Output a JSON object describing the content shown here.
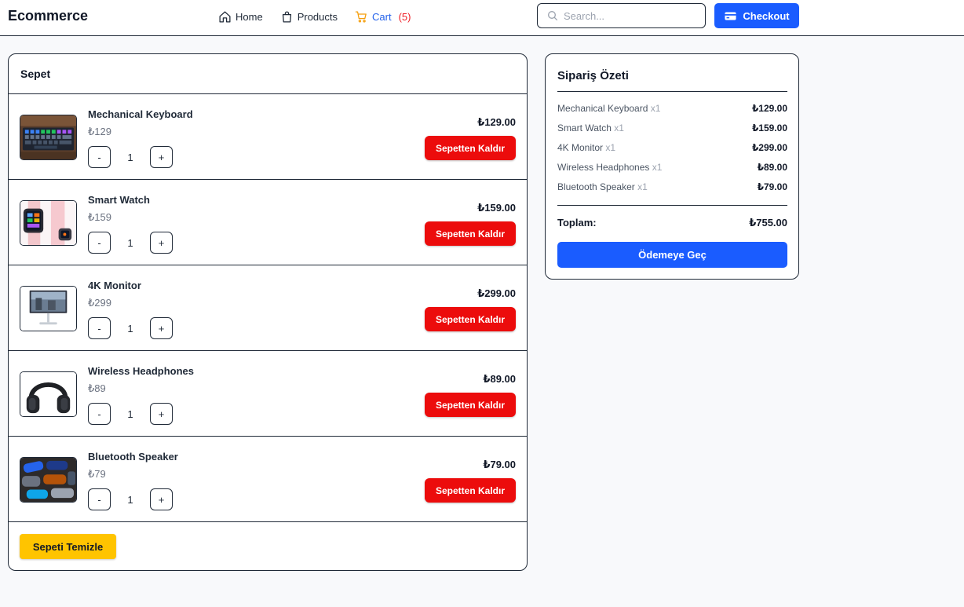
{
  "header": {
    "brand": "Ecommerce",
    "nav": {
      "home": "Home",
      "products": "Products",
      "cart": "Cart",
      "cart_count": "(5)"
    },
    "search_placeholder": "Search...",
    "checkout_label": "Checkout"
  },
  "cart": {
    "title": "Sepet",
    "items": [
      {
        "name": "Mechanical Keyboard",
        "unit_price": "₺129",
        "quantity": "1",
        "line_total": "₺129.00",
        "remove_label": "Sepetten Kaldır",
        "image": "keyboard-image"
      },
      {
        "name": "Smart Watch",
        "unit_price": "₺159",
        "quantity": "1",
        "line_total": "₺159.00",
        "remove_label": "Sepetten Kaldır",
        "image": "smartwatch-image"
      },
      {
        "name": "4K Monitor",
        "unit_price": "₺299",
        "quantity": "1",
        "line_total": "₺299.00",
        "remove_label": "Sepetten Kaldır",
        "image": "monitor-image"
      },
      {
        "name": "Wireless Headphones",
        "unit_price": "₺89",
        "quantity": "1",
        "line_total": "₺89.00",
        "remove_label": "Sepetten Kaldır",
        "image": "headphones-image"
      },
      {
        "name": "Bluetooth Speaker",
        "unit_price": "₺79",
        "quantity": "1",
        "line_total": "₺79.00",
        "remove_label": "Sepetten Kaldır",
        "image": "speaker-image"
      }
    ],
    "decrement_label": "-",
    "increment_label": "+",
    "clear_label": "Sepeti Temizle"
  },
  "summary": {
    "title": "Sipariş Özeti",
    "lines": [
      {
        "name": "Mechanical Keyboard",
        "qty": "x1",
        "amount": "₺129.00"
      },
      {
        "name": "Smart Watch",
        "qty": "x1",
        "amount": "₺159.00"
      },
      {
        "name": "4K Monitor",
        "qty": "x1",
        "amount": "₺299.00"
      },
      {
        "name": "Wireless Headphones",
        "qty": "x1",
        "amount": "₺89.00"
      },
      {
        "name": "Bluetooth Speaker",
        "qty": "x1",
        "amount": "₺79.00"
      }
    ],
    "total_label": "Toplam:",
    "total_value": "₺755.00",
    "pay_label": "Ödemeye Geç"
  },
  "colors": {
    "primary": "#1a5cff",
    "danger": "#ec0c0c",
    "warning": "#ffc400",
    "cart_link": "#2563eb",
    "cart_count": "#ef1c24"
  }
}
